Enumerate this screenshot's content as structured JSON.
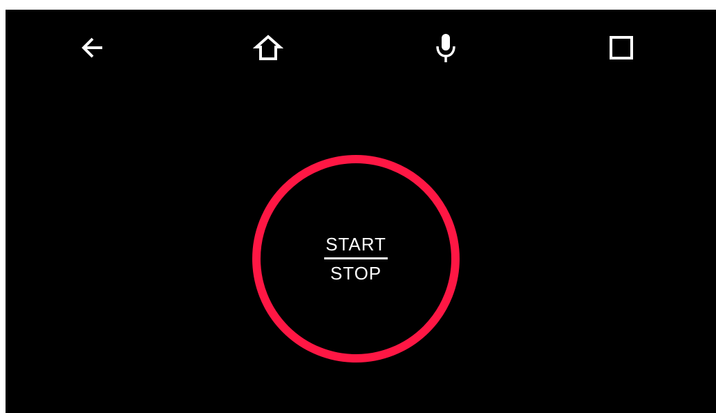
{
  "nav_bar": {
    "buttons": [
      {
        "id": "back",
        "icon": "back-arrow-icon"
      },
      {
        "id": "home",
        "icon": "home-icon"
      },
      {
        "id": "voice",
        "icon": "microphone-icon"
      },
      {
        "id": "recents",
        "icon": "square-icon"
      }
    ]
  },
  "control": {
    "start_label": "START",
    "stop_label": "STOP",
    "ring_color": "#ff1744"
  },
  "colors": {
    "background": "#000000",
    "foreground": "#ffffff",
    "accent": "#ff1744"
  }
}
